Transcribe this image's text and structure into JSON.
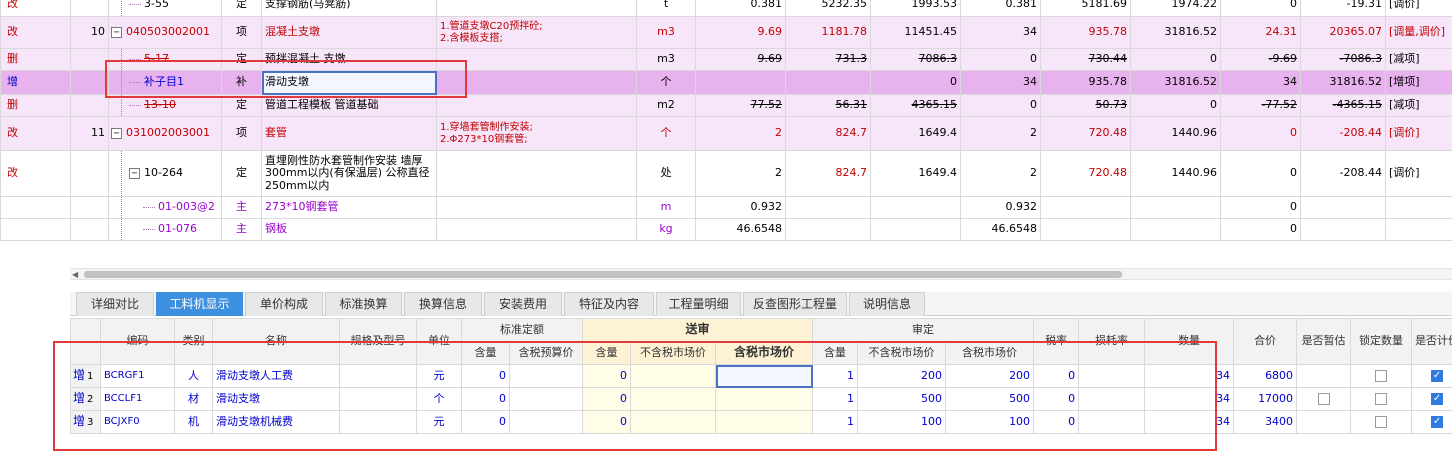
{
  "top_rows": [
    {
      "mark": "改",
      "no": "",
      "code": "3-55",
      "type": "定",
      "name": "支撑钢筋(马凳筋)",
      "feature": "",
      "unit": "t",
      "qty": "0.381",
      "price": "5232.35",
      "total": "1993.53",
      "sqty": "0.381",
      "sprice": "5181.69",
      "stotal": "1974.22",
      "d1": "0",
      "d2": "-19.31",
      "note": "[调价]"
    },
    {
      "mark": "改",
      "no": "10",
      "code": "040503002001",
      "type": "项",
      "name": "混凝土支墩",
      "feature": "1.管道支墩C20预拌砼;\n2.含模板支搭;",
      "unit": "m3",
      "qty": "9.69",
      "price": "1181.78",
      "total": "11451.45",
      "sqty": "34",
      "sprice": "935.78",
      "stotal": "31816.52",
      "d1": "24.31",
      "d2": "20365.07",
      "note": "[调量,调价]"
    },
    {
      "mark": "删",
      "no": "",
      "code": "5-17",
      "type": "定",
      "name": "预拌混凝土 支墩",
      "feature": "",
      "unit": "m3",
      "qty": "9.69",
      "price": "731.3",
      "total": "7086.3",
      "sqty": "0",
      "sprice": "730.44",
      "stotal": "0",
      "d1": "-9.69",
      "d2": "-7086.3",
      "note": "[减项]"
    },
    {
      "mark": "增",
      "no": "",
      "code": "补子目1",
      "type": "补",
      "name": "滑动支墩",
      "feature": "",
      "unit": "个",
      "qty": "",
      "price": "",
      "total": "0",
      "sqty": "34",
      "sprice": "935.78",
      "stotal": "31816.52",
      "d1": "34",
      "d2": "31816.52",
      "note": "[增项]"
    },
    {
      "mark": "删",
      "no": "",
      "code": "13-10",
      "type": "定",
      "name": "管道工程模板 管道基础",
      "feature": "",
      "unit": "m2",
      "qty": "77.52",
      "price": "56.31",
      "total": "4365.15",
      "sqty": "0",
      "sprice": "50.73",
      "stotal": "0",
      "d1": "-77.52",
      "d2": "-4365.15",
      "note": "[减项]"
    },
    {
      "mark": "改",
      "no": "11",
      "code": "031002003001",
      "type": "项",
      "name": "套管",
      "feature": "1.穿墙套管制作安装;\n2.Φ273*10钢套管;",
      "unit": "个",
      "qty": "2",
      "price": "824.7",
      "total": "1649.4",
      "sqty": "2",
      "sprice": "720.48",
      "stotal": "1440.96",
      "d1": "0",
      "d2": "-208.44",
      "note": "[调价]"
    },
    {
      "mark": "改",
      "no": "",
      "code": "10-264",
      "type": "定",
      "name": "直埋刚性防水套管制作安装 墙厚300mm以内(有保温层) 公称直径250mm以内",
      "feature": "",
      "unit": "处",
      "qty": "2",
      "price": "824.7",
      "total": "1649.4",
      "sqty": "2",
      "sprice": "720.48",
      "stotal": "1440.96",
      "d1": "0",
      "d2": "-208.44",
      "note": "[调价]"
    },
    {
      "mark": "",
      "no": "",
      "code": "01-003@2",
      "type": "主",
      "name": "273*10钢套管",
      "feature": "",
      "unit": "m",
      "qty": "0.932",
      "price": "",
      "total": "",
      "sqty": "0.932",
      "sprice": "",
      "stotal": "",
      "d1": "0",
      "d2": "",
      "note": ""
    },
    {
      "mark": "",
      "no": "",
      "code": "01-076",
      "type": "主",
      "name": "钢板",
      "feature": "",
      "unit": "kg",
      "qty": "46.6548",
      "price": "",
      "total": "",
      "sqty": "46.6548",
      "sprice": "",
      "stotal": "",
      "d1": "0",
      "d2": "",
      "note": ""
    }
  ],
  "tabs": [
    "详细对比",
    "工料机显示",
    "单价构成",
    "标准换算",
    "换算信息",
    "安装费用",
    "特征及内容",
    "工程量明细",
    "反查图形工程量",
    "说明信息"
  ],
  "active_tab_index": 1,
  "bottom_headers": {
    "code": "编码",
    "type": "类别",
    "name": "名称",
    "spec": "规格及型号",
    "unit": "单位",
    "standard": "标准定额",
    "songshen": "送审",
    "shending": "审定",
    "qty": "含量",
    "tax_budget_price": "含税预算价",
    "no_tax_market": "不含税市场价",
    "tax_market": "含税市场价",
    "tax_rate": "税率",
    "loss_rate": "损耗率",
    "amount": "数量",
    "total": "合价",
    "is_estimate": "是否暂估",
    "lock_qty": "锁定数量",
    "is_priced": "是否计价"
  },
  "bottom_rows": [
    {
      "mark": "增",
      "no": "1",
      "code": "BCRGF1",
      "type": "人",
      "name": "滑动支墩人工费",
      "spec": "",
      "unit": "元",
      "std_qty": "0",
      "std_price": "",
      "ss_qty": "0",
      "ss_notax": "",
      "ss_tax": "",
      "sd_qty": "1",
      "sd_notax": "200",
      "sd_tax": "200",
      "tax_rate": "0",
      "loss": "",
      "amount": "34",
      "total": "6800",
      "is_estimate": false,
      "show_estimate": false,
      "lock_qty": false,
      "is_priced": true
    },
    {
      "mark": "增",
      "no": "2",
      "code": "BCCLF1",
      "type": "材",
      "name": "滑动支墩",
      "spec": "",
      "unit": "个",
      "std_qty": "0",
      "std_price": "",
      "ss_qty": "0",
      "ss_notax": "",
      "ss_tax": "",
      "sd_qty": "1",
      "sd_notax": "500",
      "sd_tax": "500",
      "tax_rate": "0",
      "loss": "",
      "amount": "34",
      "total": "17000",
      "is_estimate": false,
      "show_estimate": true,
      "lock_qty": false,
      "is_priced": true
    },
    {
      "mark": "增",
      "no": "3",
      "code": "BCJXF0",
      "type": "机",
      "name": "滑动支墩机械费",
      "spec": "",
      "unit": "元",
      "std_qty": "0",
      "std_price": "",
      "ss_qty": "0",
      "ss_notax": "",
      "ss_tax": "",
      "sd_qty": "1",
      "sd_notax": "100",
      "sd_tax": "100",
      "tax_rate": "0",
      "loss": "",
      "amount": "34",
      "total": "3400",
      "is_estimate": false,
      "show_estimate": false,
      "lock_qty": false,
      "is_priced": true
    }
  ],
  "colors": {
    "accent": "#3d8fe0",
    "highlight_box": "#e23a3a",
    "selected_row": "#e8b2ef",
    "pink_row": "#f7e6fa",
    "red_text": "#c00000",
    "purple_text": "#9900cc",
    "blue_text": "#0000cc"
  }
}
